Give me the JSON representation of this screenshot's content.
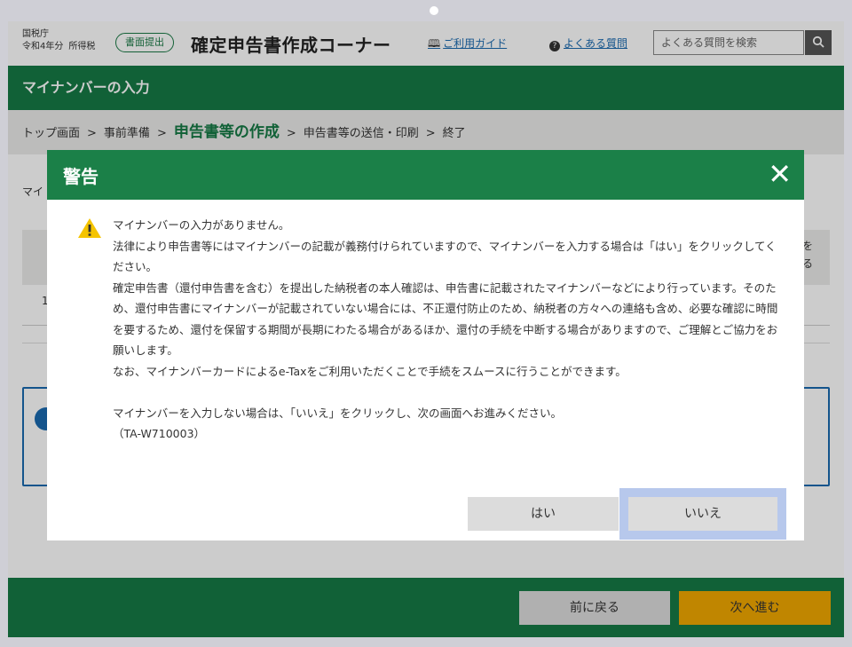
{
  "header": {
    "agency": "国税庁",
    "year": "令和4年分",
    "tax_type": "所得税",
    "submit_badge": "書面提出",
    "site_title": "確定申告書作成コーナー",
    "guide_link": "ご利用ガイド",
    "faq_link": "よくある質問",
    "search_placeholder": "よくある質問を検索"
  },
  "page": {
    "title": "マイナンバーの入力"
  },
  "breadcrumb": {
    "items": [
      "トップ画面",
      "事前準備",
      "申告書等の作成",
      "申告書等の送信・印刷",
      "終了"
    ],
    "separator": ">"
  },
  "background": {
    "label_partial": "マイ",
    "row_number": "1",
    "side_text_1": "を",
    "side_text_2": "る"
  },
  "footer": {
    "back_label": "前に戻る",
    "next_label": "次へ進む"
  },
  "modal": {
    "title": "警告",
    "close_symbol": "✕",
    "lines": [
      "マイナンバーの入力がありません。",
      "法律により申告書等にはマイナンバーの記載が義務付けられていますので、マイナンバーを入力する場合は「はい」をクリックしてください。",
      "確定申告書（還付申告書を含む）を提出した納税者の本人確認は、申告書に記載されたマイナンバーなどにより行っています。そのため、還付申告書にマイナンバーが記載されていない場合には、不正還付防止のため、納税者の方々への連絡も含め、必要な確認に時間を要するため、還付を保留する期間が長期にわたる場合があるほか、還付の手続を中断する場合がありますので、ご理解とご協力をお願いします。",
      "なお、マイナンバーカードによるe-Taxをご利用いただくことで手続をスムースに行うことができます。",
      "マイナンバーを入力しない場合は、「いいえ」をクリックし、次の画面へお進みください。",
      "（TA-W710003）"
    ],
    "yes_label": "はい",
    "no_label": "いいえ"
  },
  "colors": {
    "brand_green": "#167a45",
    "modal_green": "#1b8048",
    "next_button": "#f0a800",
    "link_blue": "#1a6ab0",
    "focus_ring": "#b7c8ec",
    "warning_yellow": "#f5c400"
  }
}
